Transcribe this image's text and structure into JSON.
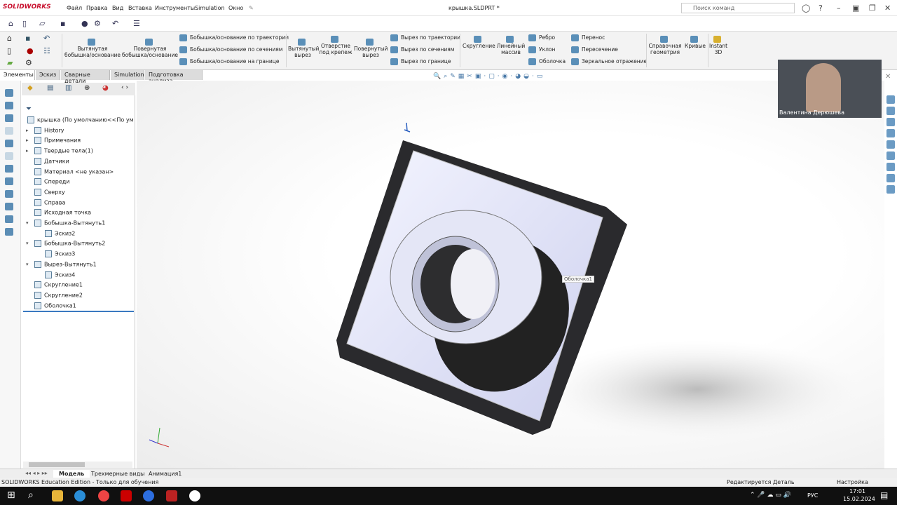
{
  "app": {
    "logo": "SOLIDWORKS",
    "doc_title": "крышка.SLDPRT *",
    "search_placeholder": "Поиск команд"
  },
  "menu": [
    "Файл",
    "Правка",
    "Вид",
    "Вставка",
    "Инструменты",
    "Simulation",
    "Окно"
  ],
  "ribbon": {
    "extrude_boss": "Вытянутая бобышка/основание",
    "revolve_boss": "Повернутая бобышка/основание",
    "sweep_boss": "Бобышка/основание по траектории",
    "loft_boss": "Бобышка/основание по сечениям",
    "boundary_boss": "Бобышка/основание на границе",
    "extrude_cut": "Вытянутый вырез",
    "hole": "Отверстие под крепеж",
    "revolve_cut": "Повернутый вырез",
    "sweep_cut": "Вырез по траектории",
    "loft_cut": "Вырез по сечениям",
    "boundary_cut": "Вырез по границе",
    "fillet": "Скругление",
    "pattern": "Линейный массив",
    "rib": "Ребро",
    "draft": "Уклон",
    "shell": "Оболочка",
    "wrap": "Перенос",
    "intersect": "Пересечение",
    "mirror": "Зеркальное отражение",
    "ref_geom": "Справочная геометрия",
    "curves": "Кривые",
    "instant3d": "Instant 3D"
  },
  "tabs": [
    "Элементы",
    "Эскиз",
    "Сварные детали",
    "Simulation",
    "Подготовка анализа"
  ],
  "tree": [
    {
      "label": "крышка  (По умолчанию<<По ум",
      "level": 0,
      "arrow": ""
    },
    {
      "label": "History",
      "level": 1,
      "arrow": "▸"
    },
    {
      "label": "Примечания",
      "level": 1,
      "arrow": "▸"
    },
    {
      "label": "Твердые тела(1)",
      "level": 1,
      "arrow": "▸"
    },
    {
      "label": "Датчики",
      "level": 1,
      "arrow": ""
    },
    {
      "label": "Материал <не указан>",
      "level": 1,
      "arrow": ""
    },
    {
      "label": "Спереди",
      "level": 1,
      "arrow": ""
    },
    {
      "label": "Сверху",
      "level": 1,
      "arrow": ""
    },
    {
      "label": "Справа",
      "level": 1,
      "arrow": ""
    },
    {
      "label": "Исходная точка",
      "level": 1,
      "arrow": ""
    },
    {
      "label": "Бобышка-Вытянуть1",
      "level": 1,
      "arrow": "▾"
    },
    {
      "label": "Эскиз2",
      "level": 2,
      "arrow": ""
    },
    {
      "label": "Бобышка-Вытянуть2",
      "level": 1,
      "arrow": "▾"
    },
    {
      "label": "Эскиз3",
      "level": 2,
      "arrow": ""
    },
    {
      "label": "Вырез-Вытянуть1",
      "level": 1,
      "arrow": "▾"
    },
    {
      "label": "Эскиз4",
      "level": 2,
      "arrow": ""
    },
    {
      "label": "Скругление1",
      "level": 1,
      "arrow": ""
    },
    {
      "label": "Скругление2",
      "level": 1,
      "arrow": ""
    },
    {
      "label": "Оболочка1",
      "level": 1,
      "arrow": ""
    }
  ],
  "tooltip": "Оболочка1",
  "video_name": "Валентина Дерюшева",
  "bottom_tabs": [
    "Модель",
    "Трехмерные виды",
    "Анимация1"
  ],
  "status": {
    "left": "SOLIDWORKS Education Edition - Только для обучения",
    "mid": "Редактируется Деталь",
    "right": "Настройка"
  },
  "taskbar": {
    "lang": "РУС",
    "time": "17:01",
    "date": "15.02.2024"
  }
}
